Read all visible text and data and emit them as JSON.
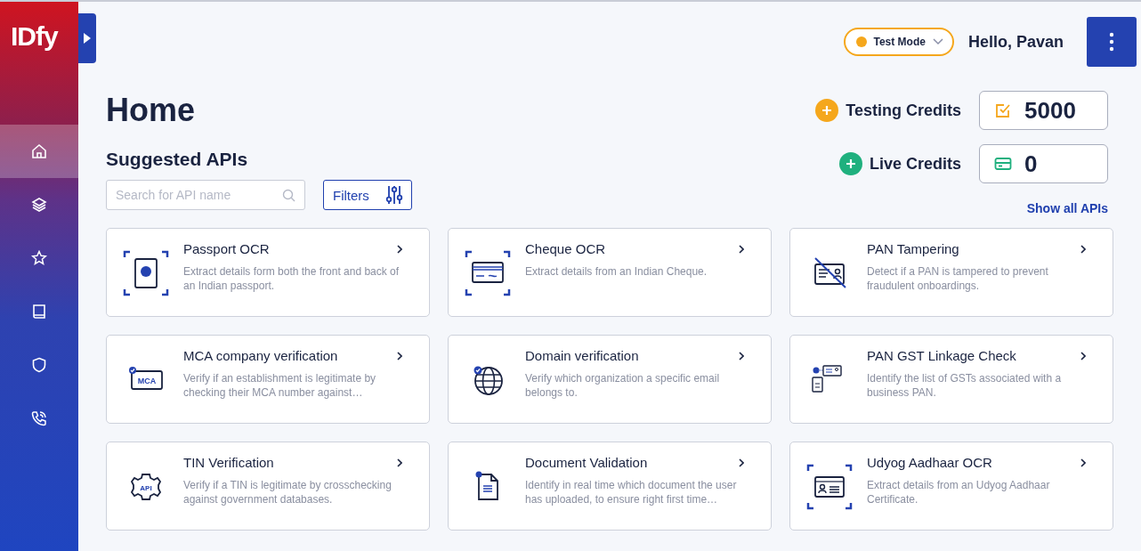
{
  "logo": "IDfy",
  "sidebar": {
    "items": [
      {
        "kind": "home",
        "selected": true
      },
      {
        "kind": "layers",
        "selected": false
      },
      {
        "kind": "star",
        "selected": false
      },
      {
        "kind": "book",
        "selected": false
      },
      {
        "kind": "shield",
        "selected": false
      },
      {
        "kind": "phone",
        "selected": false
      }
    ]
  },
  "topbar": {
    "mode": "Test Mode",
    "greeting": "Hello, Pavan"
  },
  "title": "Home",
  "section_title": "Suggested APIs",
  "search": {
    "placeholder": "Search for API name"
  },
  "filters_button": "Filters",
  "credits": [
    {
      "kind": "testing",
      "label": "Testing Credits",
      "value": "5000",
      "color": "#f5a71c"
    },
    {
      "kind": "live",
      "label": "Live Credits",
      "value": "0",
      "color": "#1fb07e"
    }
  ],
  "show_all": "Show all APIs",
  "apis": [
    {
      "kind": "passport",
      "title": "Passport OCR",
      "description": "Extract details form both the front and back of an Indian passport."
    },
    {
      "kind": "cheque",
      "title": "Cheque OCR",
      "description": "Extract details from an Indian Cheque."
    },
    {
      "kind": "pan-tamper",
      "title": "PAN Tampering",
      "description": "Detect if a PAN is tampered to prevent fraudulent onboardings."
    },
    {
      "kind": "mca",
      "title": "MCA company verification",
      "description": "Verify if an establishment is legitimate by checking their MCA number against…",
      "icon_text": "MCA"
    },
    {
      "kind": "globe",
      "title": "Domain verification",
      "description": "Verify which organization a specific email belongs to."
    },
    {
      "kind": "pan-gst",
      "title": "PAN GST Linkage Check",
      "description": "Identify the list of GSTs associated with a business PAN."
    },
    {
      "kind": "api-gear",
      "title": "TIN Verification",
      "description": "Verify if a TIN is legitimate by crosschecking against government databases.",
      "icon_text": "API"
    },
    {
      "kind": "document",
      "title": "Document Validation",
      "description": "Identify in real time which document the user has uploaded, to ensure right first time…"
    },
    {
      "kind": "aadhaar",
      "title": "Udyog Aadhaar OCR",
      "description": "Extract details from an Udyog Aadhaar Certificate."
    }
  ]
}
